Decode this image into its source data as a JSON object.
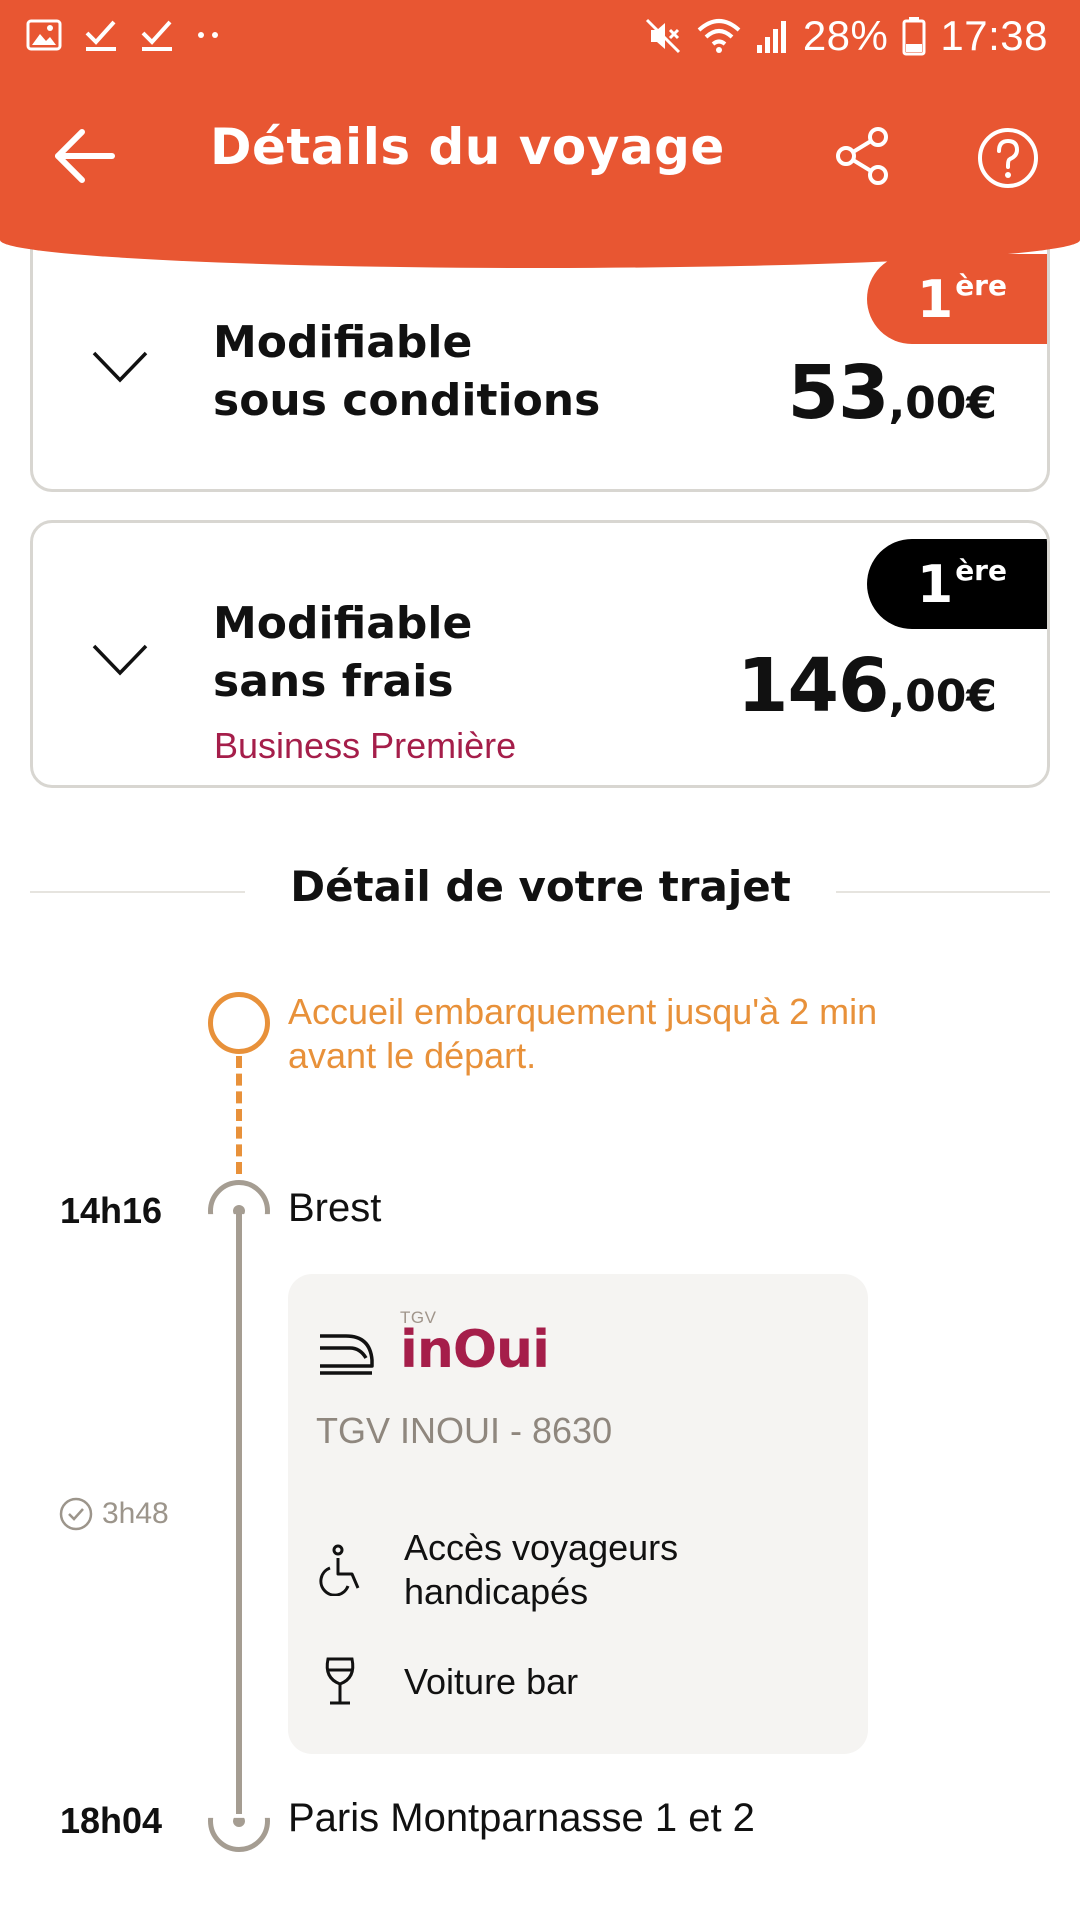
{
  "status_bar": {
    "battery": "28%",
    "clock": "17:38",
    "notification_icons": [
      "image-icon",
      "check-icon",
      "check-icon",
      "dots-icon"
    ],
    "system_icons": [
      "mute-icon",
      "wifi-icon",
      "signal-icon",
      "battery-icon"
    ]
  },
  "header": {
    "title": "Détails du voyage",
    "color": "#e85632"
  },
  "fares": [
    {
      "title_line1": "Modifiable",
      "title_line2": "sous conditions",
      "subtitle": "",
      "class_num": "1",
      "class_sup": "ère",
      "badge_color": "#e85632",
      "price_int": "53",
      "price_dec": ",00€"
    },
    {
      "title_line1": "Modifiable",
      "title_line2": "sans frais",
      "subtitle": "Business Première",
      "class_num": "1",
      "class_sup": "ère",
      "badge_color": "#000000",
      "price_int": "146",
      "price_dec": ",00€"
    }
  ],
  "trip": {
    "section_title": "Détail de votre trajet",
    "boarding_note_line1": "Accueil embarquement jusqu'à 2 min",
    "boarding_note_line2": "avant le départ.",
    "departure": {
      "time": "14h16",
      "station": "Brest"
    },
    "arrival": {
      "time": "18h04",
      "station": "Paris Montparnasse 1 et 2"
    },
    "duration": "3h48",
    "train": {
      "brand_small": "TGV",
      "brand": "inOui",
      "brand_color": "#a51e4a",
      "number": "TGV INOUI - 8630",
      "services": [
        {
          "icon": "wheelchair-icon",
          "line1": "Accès voyageurs",
          "line2": "handicapés"
        },
        {
          "icon": "wine-glass-icon",
          "line1": "Voiture bar",
          "line2": ""
        }
      ]
    }
  }
}
